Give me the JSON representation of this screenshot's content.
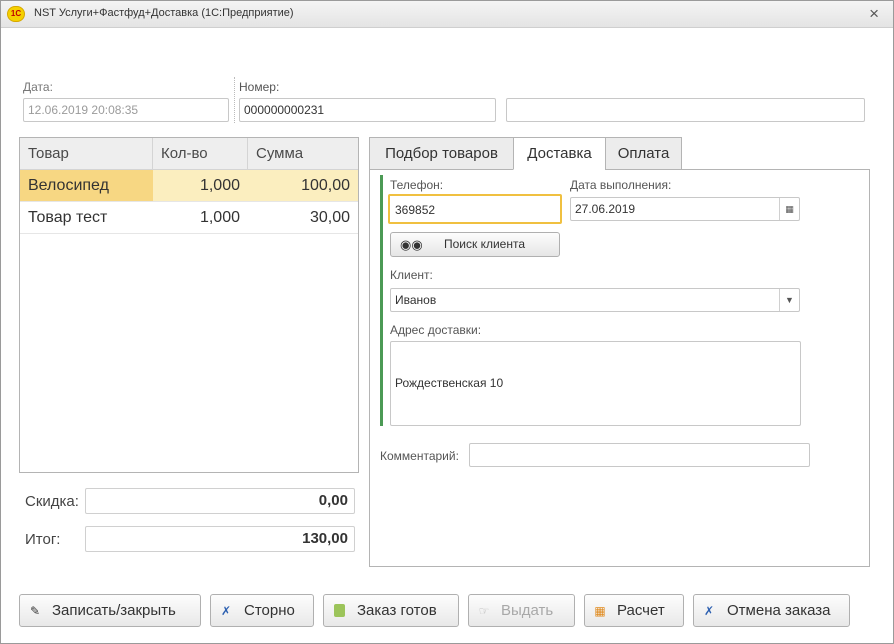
{
  "window": {
    "title": "NST Услуги+Фастфуд+Доставка  (1С:Предприятие)",
    "logo_text": "1С",
    "close_glyph": "×"
  },
  "header": {
    "date_label": "Дата:",
    "date_value": "12.06.2019 20:08:35",
    "number_label": "Номер:",
    "number_value": "000000000231",
    "extra_value": ""
  },
  "table": {
    "columns": [
      "Товар",
      "Кол-во",
      "Сумма"
    ],
    "rows": [
      {
        "product": "Велосипед",
        "qty": "1,000",
        "sum": "100,00"
      },
      {
        "product": "Товар тест",
        "qty": "1,000",
        "sum": "30,00"
      }
    ]
  },
  "totals": {
    "discount_label": "Скидка:",
    "discount_value": "0,00",
    "total_label": "Итог:",
    "total_value": "130,00"
  },
  "tabs": [
    "Подбор товаров",
    "Доставка",
    "Оплата"
  ],
  "delivery": {
    "phone_label": "Телефон:",
    "phone_value": "369852",
    "date_label": "Дата выполнения:",
    "date_value": "27.06.2019",
    "search_button": "Поиск клиента",
    "client_label": "Клиент:",
    "client_value": "Иванов",
    "address_label": "Адрес доставки:",
    "address_value": "Рождественская 10",
    "comment_label": "Комментарий:",
    "comment_value": ""
  },
  "buttons": {
    "save_close": "Записать/закрыть",
    "storno": "Сторно",
    "order_ready": "Заказ готов",
    "issue": "Выдать",
    "payment": "Расчет",
    "cancel_order": "Отмена заказа"
  },
  "colors": {
    "selected_row": "#fbeebf",
    "selected_cell": "#f7d783",
    "accent_green": "#4b9a55",
    "focus_border": "#f0c040"
  }
}
